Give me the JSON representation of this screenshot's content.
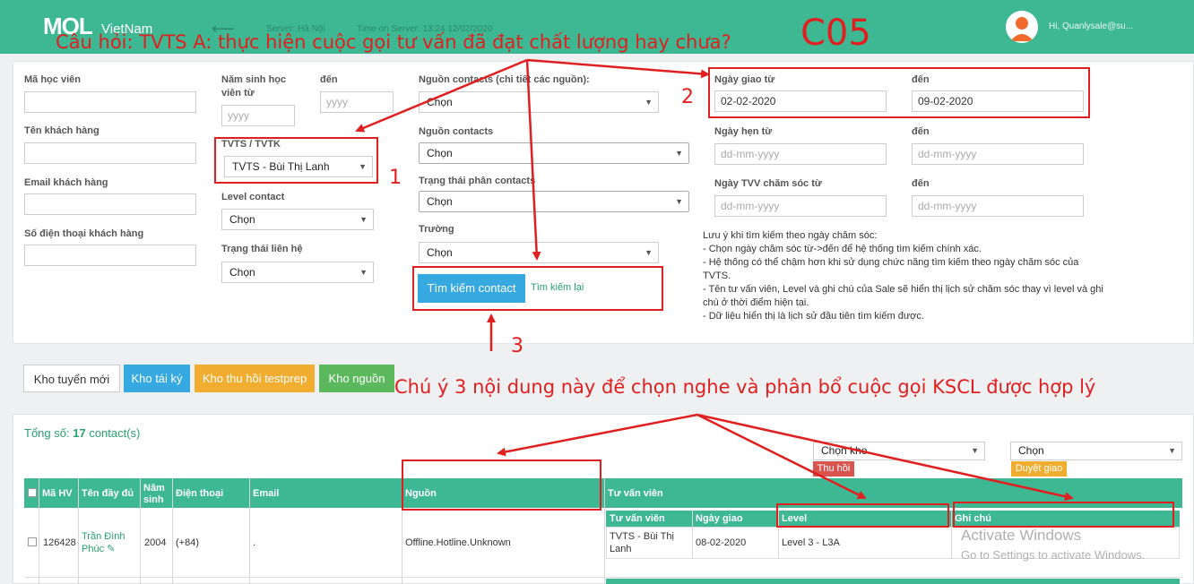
{
  "header": {
    "logo": "MOL",
    "logo_sub": "VietNam",
    "back_arrow": "⟵",
    "server": "Server: Hà Nội",
    "server_time": "Time on Server: 13:24 12/02/2020",
    "greeting": "Hi, Quanlysale@su..."
  },
  "annotations": {
    "question": "Câu hỏi: TVTS A: thực hiện cuộc gọi tư vấn đã đạt chất lượng hay chưa?",
    "code": "C05",
    "note": "Chú ý 3 nội dung này để chọn nghe và phân bổ cuộc gọi KSCL được hợp lý",
    "n1": "1",
    "n2": "2",
    "n3": "3"
  },
  "filters": {
    "student_id_label": "Mã học viên",
    "customer_name_label": "Tên khách hàng",
    "customer_email_label": "Email khách hàng",
    "customer_phone_label": "Số điện thoại khách hàng",
    "birth_year_from_label": "Năm sinh học viên từ",
    "birth_year_from_placeholder": "yyyy",
    "to_label": "đến",
    "birth_year_to_placeholder": "yyyy",
    "tvts_label": "TVTS / TVTK",
    "tvts_value": "TVTS - Bùi Thị Lanh",
    "level_label": "Level contact",
    "level_value": "Chọn",
    "contact_status_label": "Trạng thái liên hệ",
    "contact_status_value": "Chọn",
    "source_detail_label": "Nguồn contacts (chi tiết các nguồn):",
    "source_detail_value": "Chọn",
    "source_label": "Nguồn contacts",
    "source_value": "Chọn",
    "source_status_label": "Trạng thái phân contacts",
    "source_status_value": "Chọn",
    "school_label": "Trường",
    "school_value": "Chọn",
    "assign_from_label": "Ngày giao từ",
    "assign_from_value": "02-02-2020",
    "assign_to_label": "đến",
    "assign_to_value": "09-02-2020",
    "appt_from_label": "Ngày hẹn từ",
    "appt_from_placeholder": "dd-mm-yyyy",
    "appt_to_label": "đến",
    "appt_to_placeholder": "dd-mm-yyyy",
    "care_from_label": "Ngày TVV chăm sóc từ",
    "care_from_placeholder": "dd-mm-yyyy",
    "care_to_label": "đến",
    "care_to_placeholder": "dd-mm-yyyy",
    "search_button": "Tìm kiếm contact",
    "reset_link": "Tìm kiếm lại",
    "notes": [
      "Lưu ý khi tìm kiếm theo ngày chăm sóc:",
      "- Chọn ngày chăm sóc từ->đến để hệ thống tìm kiếm chính xác.",
      "- Hệ thống có thể chậm hơn khi sử dụng chức năng tìm kiếm theo ngày chăm sóc của TVTS.",
      "- Tên tư vấn viên, Level và ghi chú của Sale sẽ hiển thị lịch sử chăm sóc thay vì level và ghi chú ở thời điểm hiện tại.",
      "- Dữ liệu hiển thị là lịch sử đầu tiên tìm kiếm được."
    ]
  },
  "tabs": [
    "Kho tuyển mới",
    "Kho tái ký",
    "Kho thu hồi testprep",
    "Kho nguồn"
  ],
  "results": {
    "total_label": "Tổng số:",
    "total_count": "17",
    "total_unit": "contact(s)",
    "warehouse_select": "Chọn kho",
    "revoke_button": "Thu hồi",
    "approve_select": "Chọn",
    "approve_button": "Duyệt giao",
    "columns": [
      "Mã HV",
      "Tên đầy đủ",
      "Năm sinh",
      "Điện thoại",
      "Email",
      "Nguồn",
      "Tư vấn viên"
    ],
    "sub_columns": [
      "Tư vấn viên",
      "Ngày giao",
      "Level",
      "Ghi chú"
    ],
    "row": {
      "id": "126428",
      "name": "Trần Đình Phúc",
      "edit_icon": "✎",
      "year": "2004",
      "phone": "(+84)",
      "email": ".",
      "source": "Offline.Hotline.Unknown",
      "advisor": "TVTS - Bùi Thị Lanh",
      "assign_date": "08-02-2020",
      "level": "Level 3 - L3A",
      "note": ""
    }
  },
  "watermark": {
    "line1": "Activate Windows",
    "line2": "Go to Settings to activate Windows."
  }
}
